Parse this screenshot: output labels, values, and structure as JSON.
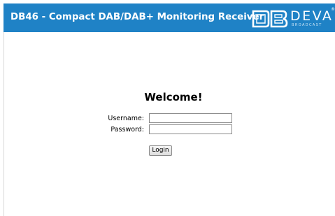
{
  "header": {
    "title": "DB46 - Compact DAB/DAB+ Monitoring Receiver",
    "background_color": "#1f82c6",
    "logo": {
      "icon": "deva-logo-icon",
      "brand": "DEVA",
      "trademark": "®",
      "subtitle": "BROADCAST"
    }
  },
  "login": {
    "heading": "Welcome!",
    "username_label": "Username:",
    "username_value": "",
    "password_label": "Password:",
    "password_value": "",
    "submit_label": "Login"
  }
}
